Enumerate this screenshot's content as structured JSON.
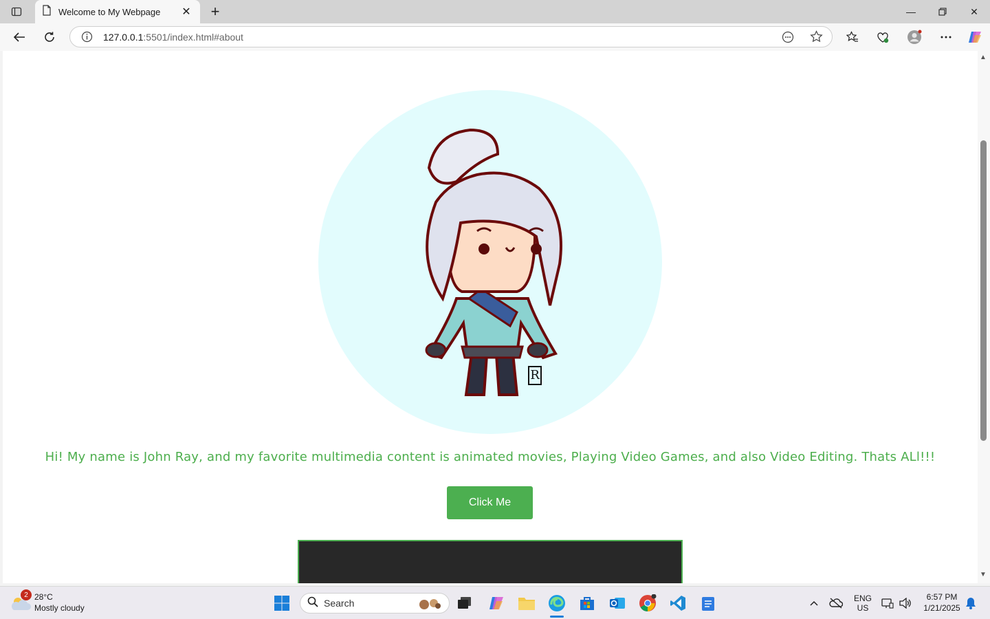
{
  "browser": {
    "tab": {
      "title": "Welcome to My Webpage"
    },
    "url": {
      "host": "127.0.0.1",
      "rest": ":5501/index.html#about"
    }
  },
  "page": {
    "intro_text": "Hi! My name is John Ray, and my favorite multimedia content is animated movies, Playing Video Games, and also Video Editing. Thats ALl!!!",
    "button_label": "Click Me",
    "avatar_bg_color": "#e2fcfd",
    "accent_color": "#4caf50"
  },
  "taskbar": {
    "weather": {
      "badge": "2",
      "temp": "28°C",
      "desc": "Mostly cloudy"
    },
    "search_label": "Search",
    "language": {
      "lang": "ENG",
      "region": "US"
    },
    "clock": {
      "time": "6:57 PM",
      "date": "1/21/2025"
    }
  }
}
